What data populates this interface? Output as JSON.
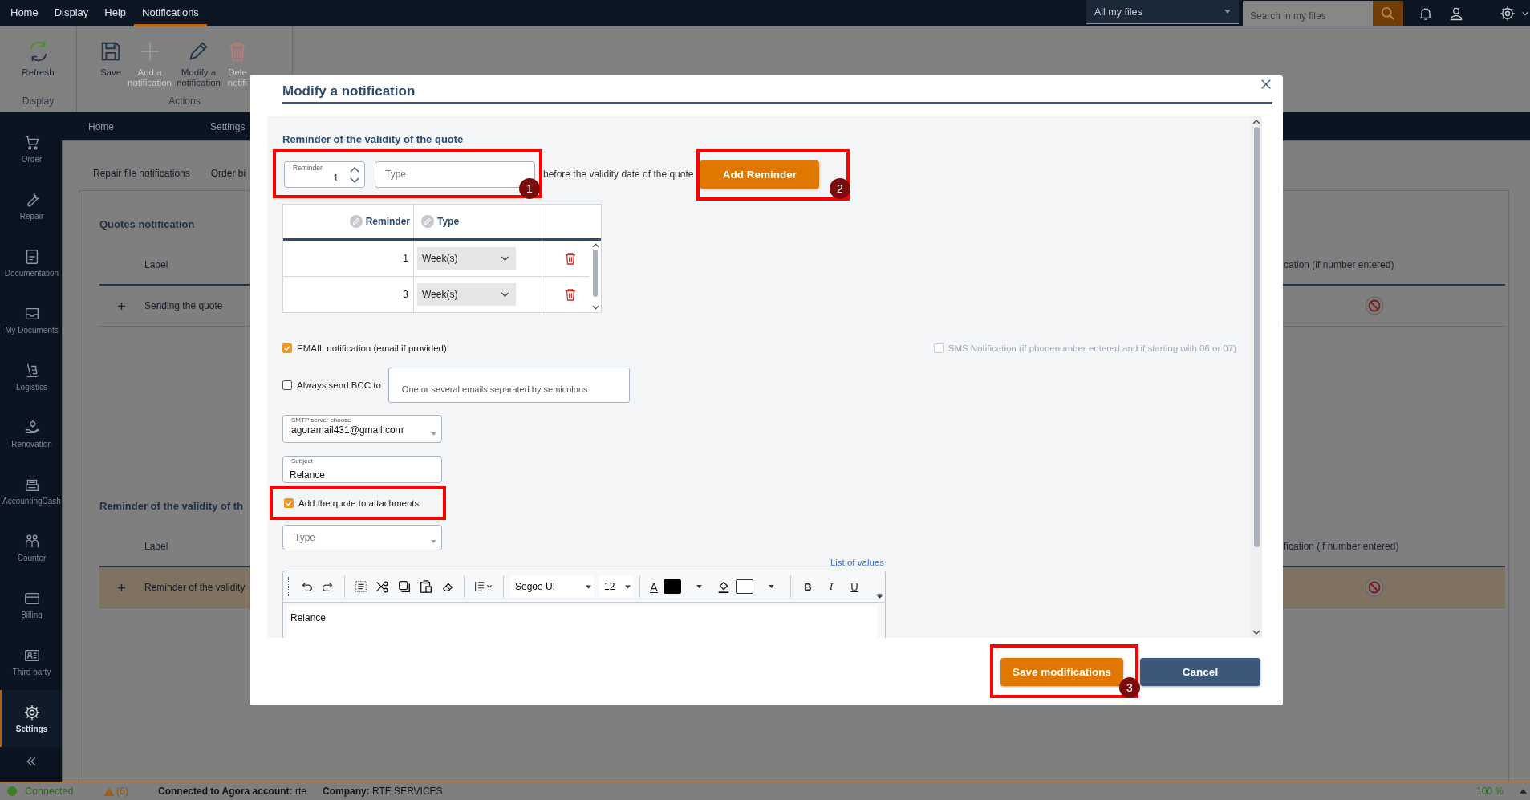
{
  "menu": [
    {
      "label": "Home",
      "selected": false
    },
    {
      "label": "Display",
      "selected": false
    },
    {
      "label": "Help",
      "selected": false
    },
    {
      "label": "Notifications",
      "selected": true
    }
  ],
  "scope_select": {
    "value": "All my files"
  },
  "search": {
    "placeholder": "Search in my files"
  },
  "ribbon": {
    "groups": [
      {
        "label": "Display",
        "buttons": [
          {
            "kind": "refresh",
            "lines": [
              "Refresh"
            ],
            "disabled": false
          }
        ]
      },
      {
        "label": "Actions",
        "buttons": [
          {
            "kind": "save",
            "lines": [
              "Save"
            ],
            "disabled": false
          },
          {
            "kind": "add",
            "lines": [
              "Add a",
              "notification"
            ],
            "disabled": true
          },
          {
            "kind": "edit",
            "lines": [
              "Modify a",
              "notification"
            ],
            "disabled": false
          },
          {
            "kind": "delete",
            "lines": [
              "Dele",
              "notifi"
            ],
            "disabled": true
          }
        ]
      }
    ]
  },
  "page_tabs": [
    {
      "label": "Home"
    },
    {
      "label": "Settings"
    }
  ],
  "sidebar": {
    "items": [
      {
        "kind": "cart",
        "label": "Order",
        "selected": false
      },
      {
        "kind": "wrench",
        "label": "Repair",
        "selected": false
      },
      {
        "kind": "document",
        "label": "Documentation",
        "selected": false
      },
      {
        "kind": "tray",
        "label": "My Documents",
        "selected": false
      },
      {
        "kind": "truck",
        "label": "Logistics",
        "selected": false
      },
      {
        "kind": "handgear",
        "label": "Renovation",
        "selected": false
      },
      {
        "kind": "register",
        "label": "AccountingCash",
        "selected": false
      },
      {
        "kind": "people",
        "label": "Counter",
        "selected": false
      },
      {
        "kind": "card",
        "label": "Billing",
        "selected": false
      },
      {
        "kind": "idcard",
        "label": "Third party",
        "selected": false
      },
      {
        "kind": "gear",
        "label": "Settings",
        "selected": true
      }
    ]
  },
  "sub_tabs": [
    {
      "label": "Repair file notifications"
    },
    {
      "label": "Order bi"
    }
  ],
  "sections": [
    {
      "title": "Quotes notification",
      "columns": [
        "Label",
        "cation (if number entered)"
      ],
      "rows": [
        {
          "label": "Sending the quote",
          "selected": false
        }
      ]
    },
    {
      "title": "Reminder of the validity of th",
      "columns": [
        "Label",
        "fication (if number entered)"
      ],
      "rows": [
        {
          "label": "Reminder of the validity",
          "selected": true
        }
      ]
    }
  ],
  "dialog": {
    "title": "Modify a notification",
    "section_title": "Reminder of the validity of the quote",
    "reminder_spinner": {
      "label": "Reminder",
      "value": "1"
    },
    "type_select": {
      "placeholder": "Type"
    },
    "before_text": "before the validity date of the quote",
    "add_button": "Add Reminder",
    "table": {
      "columns": [
        "Reminder",
        "Type"
      ],
      "rows": [
        {
          "reminder": "1",
          "type": "Week(s)"
        },
        {
          "reminder": "3",
          "type": "Week(s)"
        }
      ]
    },
    "email_notification": {
      "label": "EMAIL notification (email if provided)",
      "checked": true
    },
    "sms_notification": {
      "label": "SMS Notification (if phonenumber entered and if starting with 06 or 07)",
      "checked": false,
      "disabled": true
    },
    "bcc": {
      "label": "Always send BCC to",
      "checked": false,
      "placeholder": "One or several emails separated by semicolons"
    },
    "smtp_select": {
      "label": "SMTP server choose",
      "value": "agoramail431@gmail.com"
    },
    "subject": {
      "label": "Subject",
      "value": "Relance"
    },
    "attach_quote": {
      "label": "Add the quote to attachments",
      "checked": true
    },
    "attachment_type": {
      "placeholder": "Type"
    },
    "list_of_values_link": "List of values",
    "editor": {
      "font": "Segoe UI",
      "size": "12",
      "font_color_label": "A",
      "style_buttons": [
        {
          "label": "B",
          "kind": "bold"
        },
        {
          "label": "I",
          "kind": "italic"
        },
        {
          "label": "U",
          "kind": "underline"
        }
      ],
      "content": "Relance"
    },
    "buttons": [
      {
        "label": "Save modifications",
        "kind": "primary"
      },
      {
        "label": "Cancel",
        "kind": "secondary"
      }
    ],
    "callouts": [
      {
        "kind": "numbered",
        "number": "1"
      },
      {
        "kind": "numbered",
        "number": "2"
      },
      {
        "kind": "plain"
      },
      {
        "kind": "numbered",
        "number": "3"
      }
    ]
  },
  "status_bar": {
    "connection": "Connected",
    "warnings": "(6)",
    "account": "**Connected to Agora account:** rte",
    "company": "**Company:** RTE SERVICES",
    "zoom": "100 %"
  }
}
